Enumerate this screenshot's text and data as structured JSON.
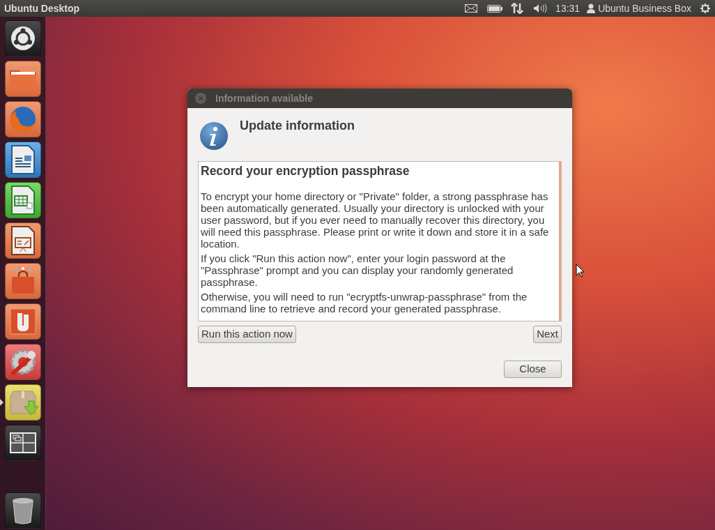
{
  "top_panel": {
    "title": "Ubuntu Desktop",
    "clock": "13:31",
    "user": "Ubuntu Business Box"
  },
  "launcher": {
    "items": [
      {
        "kind": "dash",
        "running": false
      },
      {
        "kind": "folder",
        "running": false
      },
      {
        "kind": "browser",
        "running": false
      },
      {
        "kind": "writer",
        "running": false
      },
      {
        "kind": "calc",
        "running": false
      },
      {
        "kind": "impress",
        "running": false
      },
      {
        "kind": "store",
        "running": false
      },
      {
        "kind": "one",
        "running": false
      },
      {
        "kind": "settings",
        "running": false
      },
      {
        "kind": "package",
        "running": true
      },
      {
        "kind": "workspaces",
        "running": false
      }
    ],
    "trash": {
      "kind": "trash"
    }
  },
  "dialog": {
    "title": "Information available",
    "heading": "Update information",
    "message": {
      "title": "Record your encryption passphrase",
      "paragraphs": [
        "To encrypt your home directory or \"Private\" folder, a strong passphrase has been automatically generated. Usually your directory is unlocked with your user password, but if you ever need to manually recover this directory, you will need this passphrase. Please print or write it down and store it in a safe location.",
        "If you click \"Run this action now\", enter your login password at the \"Passphrase\" prompt and you can display your randomly generated passphrase.",
        "Otherwise, you will need to run \"ecryptfs-unwrap-passphrase\" from the command line to retrieve and record your generated passphrase."
      ]
    },
    "action_button": "Run this action now",
    "next_button": "Next",
    "close_button": "Close"
  }
}
